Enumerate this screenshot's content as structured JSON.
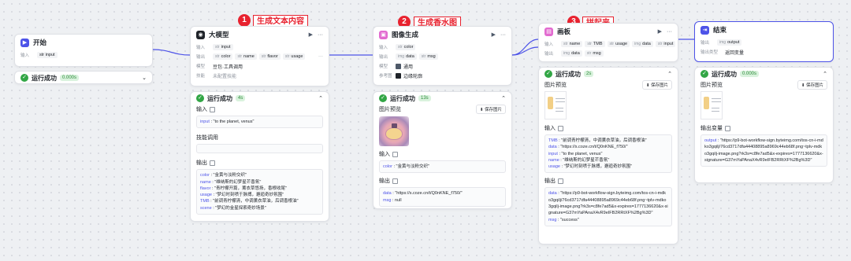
{
  "annotations": [
    {
      "num": "1",
      "label": "生成文本内容"
    },
    {
      "num": "2",
      "label": "生成香水图"
    },
    {
      "num": "3",
      "label": "拼起来"
    }
  ],
  "start": {
    "title": "开始",
    "input_label": "输入",
    "input_tag": "str input",
    "status": "运行成功",
    "time": "0.000s"
  },
  "llm": {
    "title": "大模型",
    "input_label": "输入",
    "input_tag": "input",
    "output_label": "输出",
    "outputs": [
      "color",
      "name",
      "flavor",
      "usage"
    ],
    "model_label": "模型",
    "model_value": "豆包·工具调用",
    "skill_label": "技能",
    "skill_value": "未配置技能",
    "status": "运行成功",
    "time": "4s",
    "in_title": "输入",
    "in_text": "\"to the planet, venus\"",
    "skill_call": "技能调用",
    "out_title": "输出",
    "out_lines": [
      {
        "k": "color",
        "v": "\"金黄与淡粉交织\""
      },
      {
        "k": "name",
        "v": "\"维纳斯的幻梦星芒香氛\""
      },
      {
        "k": "flavor",
        "v": "\"青柠檬开篇，薰衣草悠扬，香根收尾\""
      },
      {
        "k": "usage",
        "v": "\"梦幻时刻喷于脉搏，邂逅奇妙氛围\""
      },
      {
        "k": "TMB",
        "v": "\"前调青柠檬清，中调薰衣草油，后调香根油\""
      },
      {
        "k": "scene",
        "v": "\"梦幻的金星探索奇妙场景\""
      }
    ]
  },
  "img": {
    "title": "图像生成",
    "input_label": "输入",
    "input_tag": "color",
    "output_label": "输出",
    "outputs": [
      "data",
      "msg"
    ],
    "model_label": "模型",
    "model_value": "通用",
    "ref_label": "参考图",
    "ref_value": "边缘轮廓",
    "status": "运行成功",
    "time": "13s",
    "preview": "图片预览",
    "save": "保存图片",
    "in_title": "输入",
    "in_line": {
      "k": "color",
      "v": "\"金黄与淡粉交织\""
    },
    "out_title": "输出",
    "out_lines": [
      {
        "k": "data",
        "v": "\"https://s.coze.cn/t/Q0nKNE_f750/\""
      },
      {
        "k": "msg",
        "v": "null"
      }
    ]
  },
  "canvas": {
    "title": "画板",
    "input_label": "输入",
    "inputs": [
      "name",
      "TMB",
      "usage",
      "data",
      "input"
    ],
    "output_label": "输出",
    "outputs": [
      "data",
      "msg"
    ],
    "status": "运行成功",
    "time": "2s",
    "preview": "图片预览",
    "save": "保存图片",
    "in_title": "输入",
    "in_lines": [
      {
        "k": "TMB",
        "v": "\"前调青柠檬清，中调薰衣草油，后调香根油\""
      },
      {
        "k": "data",
        "v": "\"https://s.coze.cn/t/Q0nKNE_f750/\""
      },
      {
        "k": "input",
        "v": "\"to the planet, venus\""
      },
      {
        "k": "name",
        "v": "\"维纳斯的幻梦星芒香氛\""
      },
      {
        "k": "usage",
        "v": "\"梦幻时刻喷于脉搏，邂逅奇妙氛围\""
      }
    ],
    "out_title": "输出",
    "out_lines": [
      {
        "k": "data",
        "v": "\"https://p9-bot-workflow-sign.byteimg.com/tos-cn-i-mdko3gqilj/76cd3717dfa44408895a8969c44eb68f.png~tplv-mdko3gqilj-image.png?rk3s=c8fe7ad5&x-expires=1777136620&x-signature=G37mYaPAnaX4vR9eIFB2RRtXF%2Bg%3D\""
      },
      {
        "k": "msg",
        "v": "\"success\""
      }
    ]
  },
  "end": {
    "title": "结束",
    "output_label": "输出",
    "output_tag": "output",
    "out_type_label": "输出类型",
    "out_type_value": "返回变量",
    "status": "运行成功",
    "time": "0.000s",
    "preview": "图片预览",
    "save": "保存图片",
    "var_title": "输出变量",
    "out_line": {
      "k": "output",
      "v": "\"https://p9-bot-workflow-sign.byteimg.com/tos-cn-i-mdko3gqilj/76cd3717dfa44408895a8969c44eb68f.png~tplv-mdko3gqilj-image.png?rk3s=c8fe7ad5&x-expires=1777136620&x-signature=G37mYaPAnaX4vR9eIFB2RRtXF%2Bg%3D\""
    }
  },
  "colors": {
    "accent": "#4d53e8",
    "success": "#32a645",
    "annotation": "#e8222f"
  }
}
